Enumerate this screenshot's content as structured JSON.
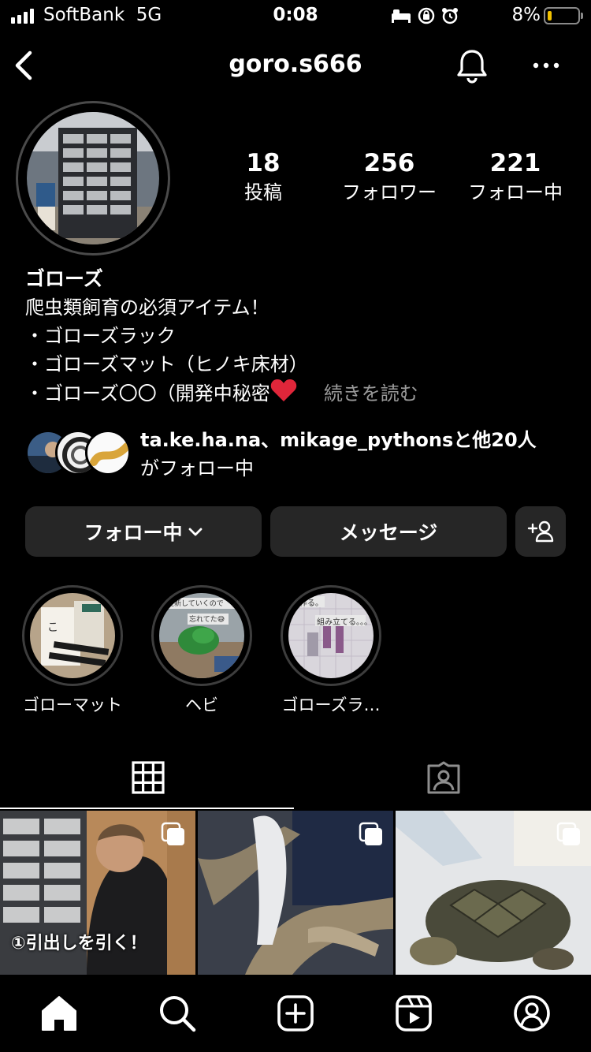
{
  "status_bar": {
    "carrier": "SoftBank",
    "network": "5G",
    "time": "0:08",
    "battery_pct": "8%",
    "battery_level": 0.08,
    "battery_color": "#f2c200"
  },
  "header": {
    "username": "goro.s666",
    "icons": [
      "chevron-left-icon",
      "bell-icon",
      "more-dots-icon"
    ]
  },
  "profile": {
    "stats": [
      {
        "count": "18",
        "label": "投稿"
      },
      {
        "count": "256",
        "label": "フォロワー"
      },
      {
        "count": "221",
        "label": "フォロー中"
      }
    ],
    "display_name": "ゴローズ",
    "bio_lines": [
      "爬虫類飼育の必須アイテム！",
      "・ゴローズラック",
      "・ゴローズマット（ヒノキ床材）",
      "・ゴローズ〇〇（開発中秘密"
    ],
    "read_more": "続きを読む",
    "followed_by": {
      "names": "ta.ke.ha.na、mikage_pythons",
      "others": "と他20人",
      "suffix": "がフォロー中"
    }
  },
  "actions": {
    "follow_label": "フォロー中",
    "message_label": "メッセージ"
  },
  "highlights": [
    {
      "label": "ゴローマット"
    },
    {
      "label": "ヘビ",
      "overlay_lines": [
        "更新していくので",
        "忘れてた😅"
      ]
    },
    {
      "label": "ゴローズラ…",
      "overlay_lines": [
        "作る。",
        "組み立てる。。。"
      ]
    }
  ],
  "tabs": [
    "grid-icon",
    "tagged-icon"
  ],
  "posts": [
    {
      "caption": "①引出しを引く！"
    },
    {
      "caption": ""
    },
    {
      "caption": ""
    }
  ],
  "bottom_nav": [
    "home-icon",
    "search-icon",
    "create-icon",
    "reels-icon",
    "profile-icon"
  ]
}
